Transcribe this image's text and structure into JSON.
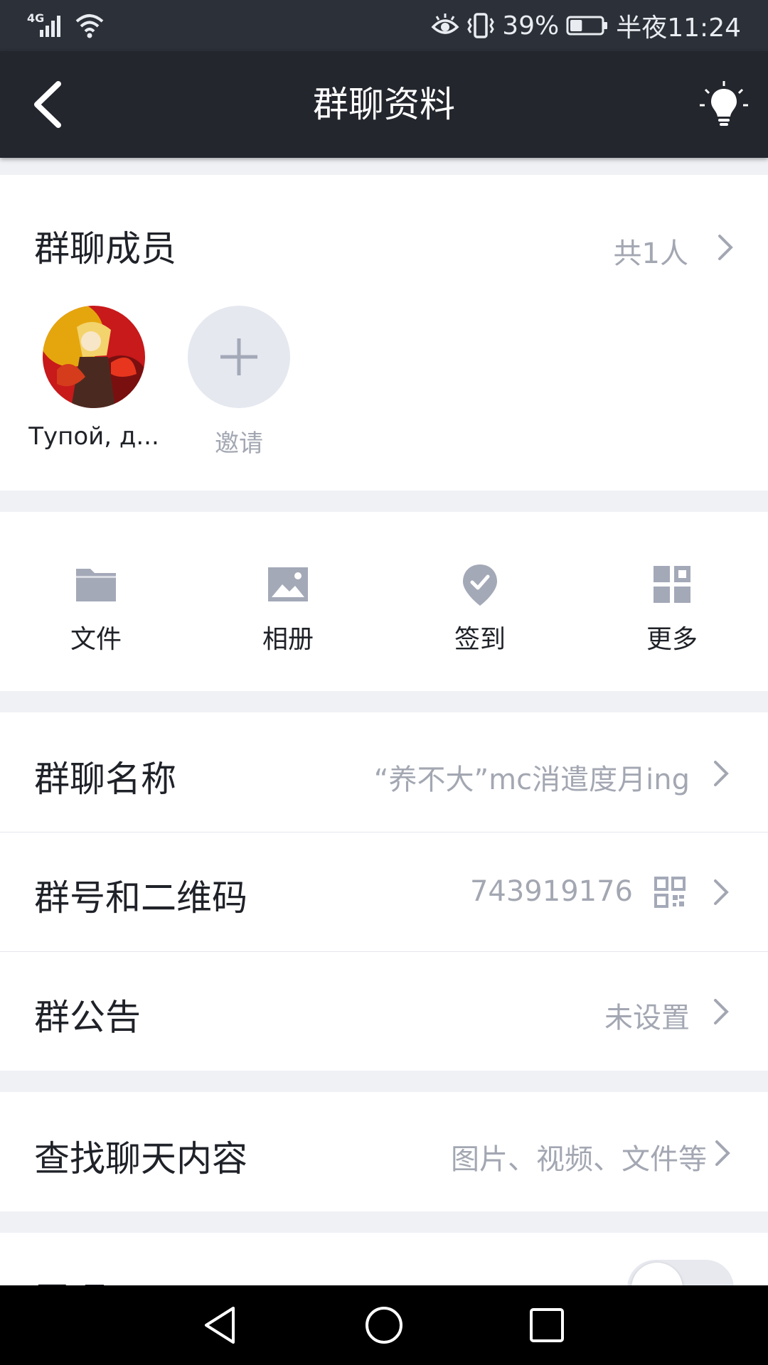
{
  "status_bar": {
    "network": "4G",
    "battery_percent": "39%",
    "time": "半夜11:24",
    "battery_level": 0.39,
    "icons": [
      "signal-icon",
      "wifi-icon",
      "eye-icon",
      "vibrate-icon",
      "battery-icon"
    ]
  },
  "header": {
    "title": "群聊资料",
    "back_icon": "back-arrow-icon",
    "right_icon": "lightbulb-icon"
  },
  "members": {
    "label": "群聊成员",
    "count": "共1人",
    "list": [
      {
        "name": "Тупой, д..."
      }
    ],
    "invite_label": "邀请"
  },
  "tools": [
    {
      "label": "文件",
      "icon": "folder-icon"
    },
    {
      "label": "相册",
      "icon": "image-icon"
    },
    {
      "label": "签到",
      "icon": "check-pin-icon"
    },
    {
      "label": "更多",
      "icon": "grid-icon"
    }
  ],
  "settings": {
    "group_name": {
      "label": "群聊名称",
      "value": "“养不大”mc消遣度月ing"
    },
    "group_number": {
      "label": "群号和二维码",
      "value": "743919176"
    },
    "announcement": {
      "label": "群公告",
      "value": "未设置"
    },
    "search": {
      "label": "查找聊天内容",
      "value": "图片、视频、文件等"
    },
    "pin": {
      "label": "置顶",
      "toggle_on": false
    }
  },
  "colors": {
    "header_bg": "#23262d",
    "status_bg": "#2c3038",
    "page_bg": "#f0f1f5",
    "icon_gray": "#a4a9b8",
    "secondary_text": "#a3a7b2"
  }
}
